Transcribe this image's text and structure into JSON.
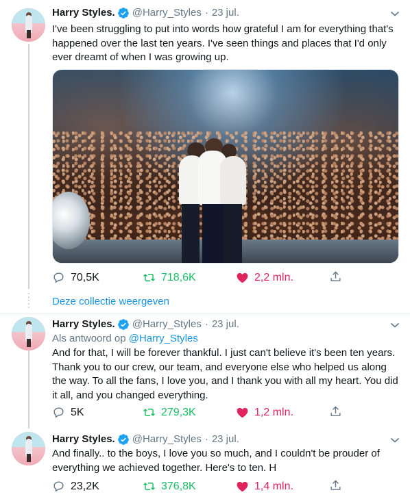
{
  "tweets": [
    {
      "name": "Harry Styles.",
      "handle": "@Harry_Styles",
      "separator": "·",
      "date": "23 jul.",
      "text": "I've been struggling to put into words how grateful I am for everything that's happened over the last ten years. I've seen things and places that I'd only ever dreamt of when I was growing up.",
      "replies": "70,5K",
      "retweets": "718,6K",
      "likes": "2,2 mln."
    },
    {
      "name": "Harry Styles.",
      "handle": "@Harry_Styles",
      "separator": "·",
      "date": "23 jul.",
      "reply_prefix": "Als antwoord op",
      "reply_handle": "@Harry_Styles",
      "text": "And for that, I will be forever thankful. I just can't believe it's been ten years. Thank you to our crew, our team, and everyone else who helped us along the way. To all the fans, I love you, and I thank you with all my heart. You did it all, and you changed everything.",
      "replies": "5K",
      "retweets": "279,3K",
      "likes": "1,2 mln."
    },
    {
      "name": "Harry Styles.",
      "handle": "@Harry_Styles",
      "separator": "·",
      "date": "23 jul.",
      "text": "And finally.. to the boys, I love you so much, and I couldn't be prouder of everything we achieved together. Here's to ten. H",
      "replies": "23,2K",
      "retweets": "376,8K",
      "likes": "1,4 mln."
    }
  ],
  "show_collection": "Deze collectie weergeven",
  "colors": {
    "text": "#14171a",
    "secondary": "#657786",
    "link": "#1b95e0",
    "retweet": "#17bf63",
    "like": "#e0245e",
    "verified": "#1da1f2"
  },
  "icons": [
    "reply-icon",
    "retweet-icon",
    "like-icon",
    "share-icon",
    "verified-icon",
    "chevron-down-icon"
  ]
}
